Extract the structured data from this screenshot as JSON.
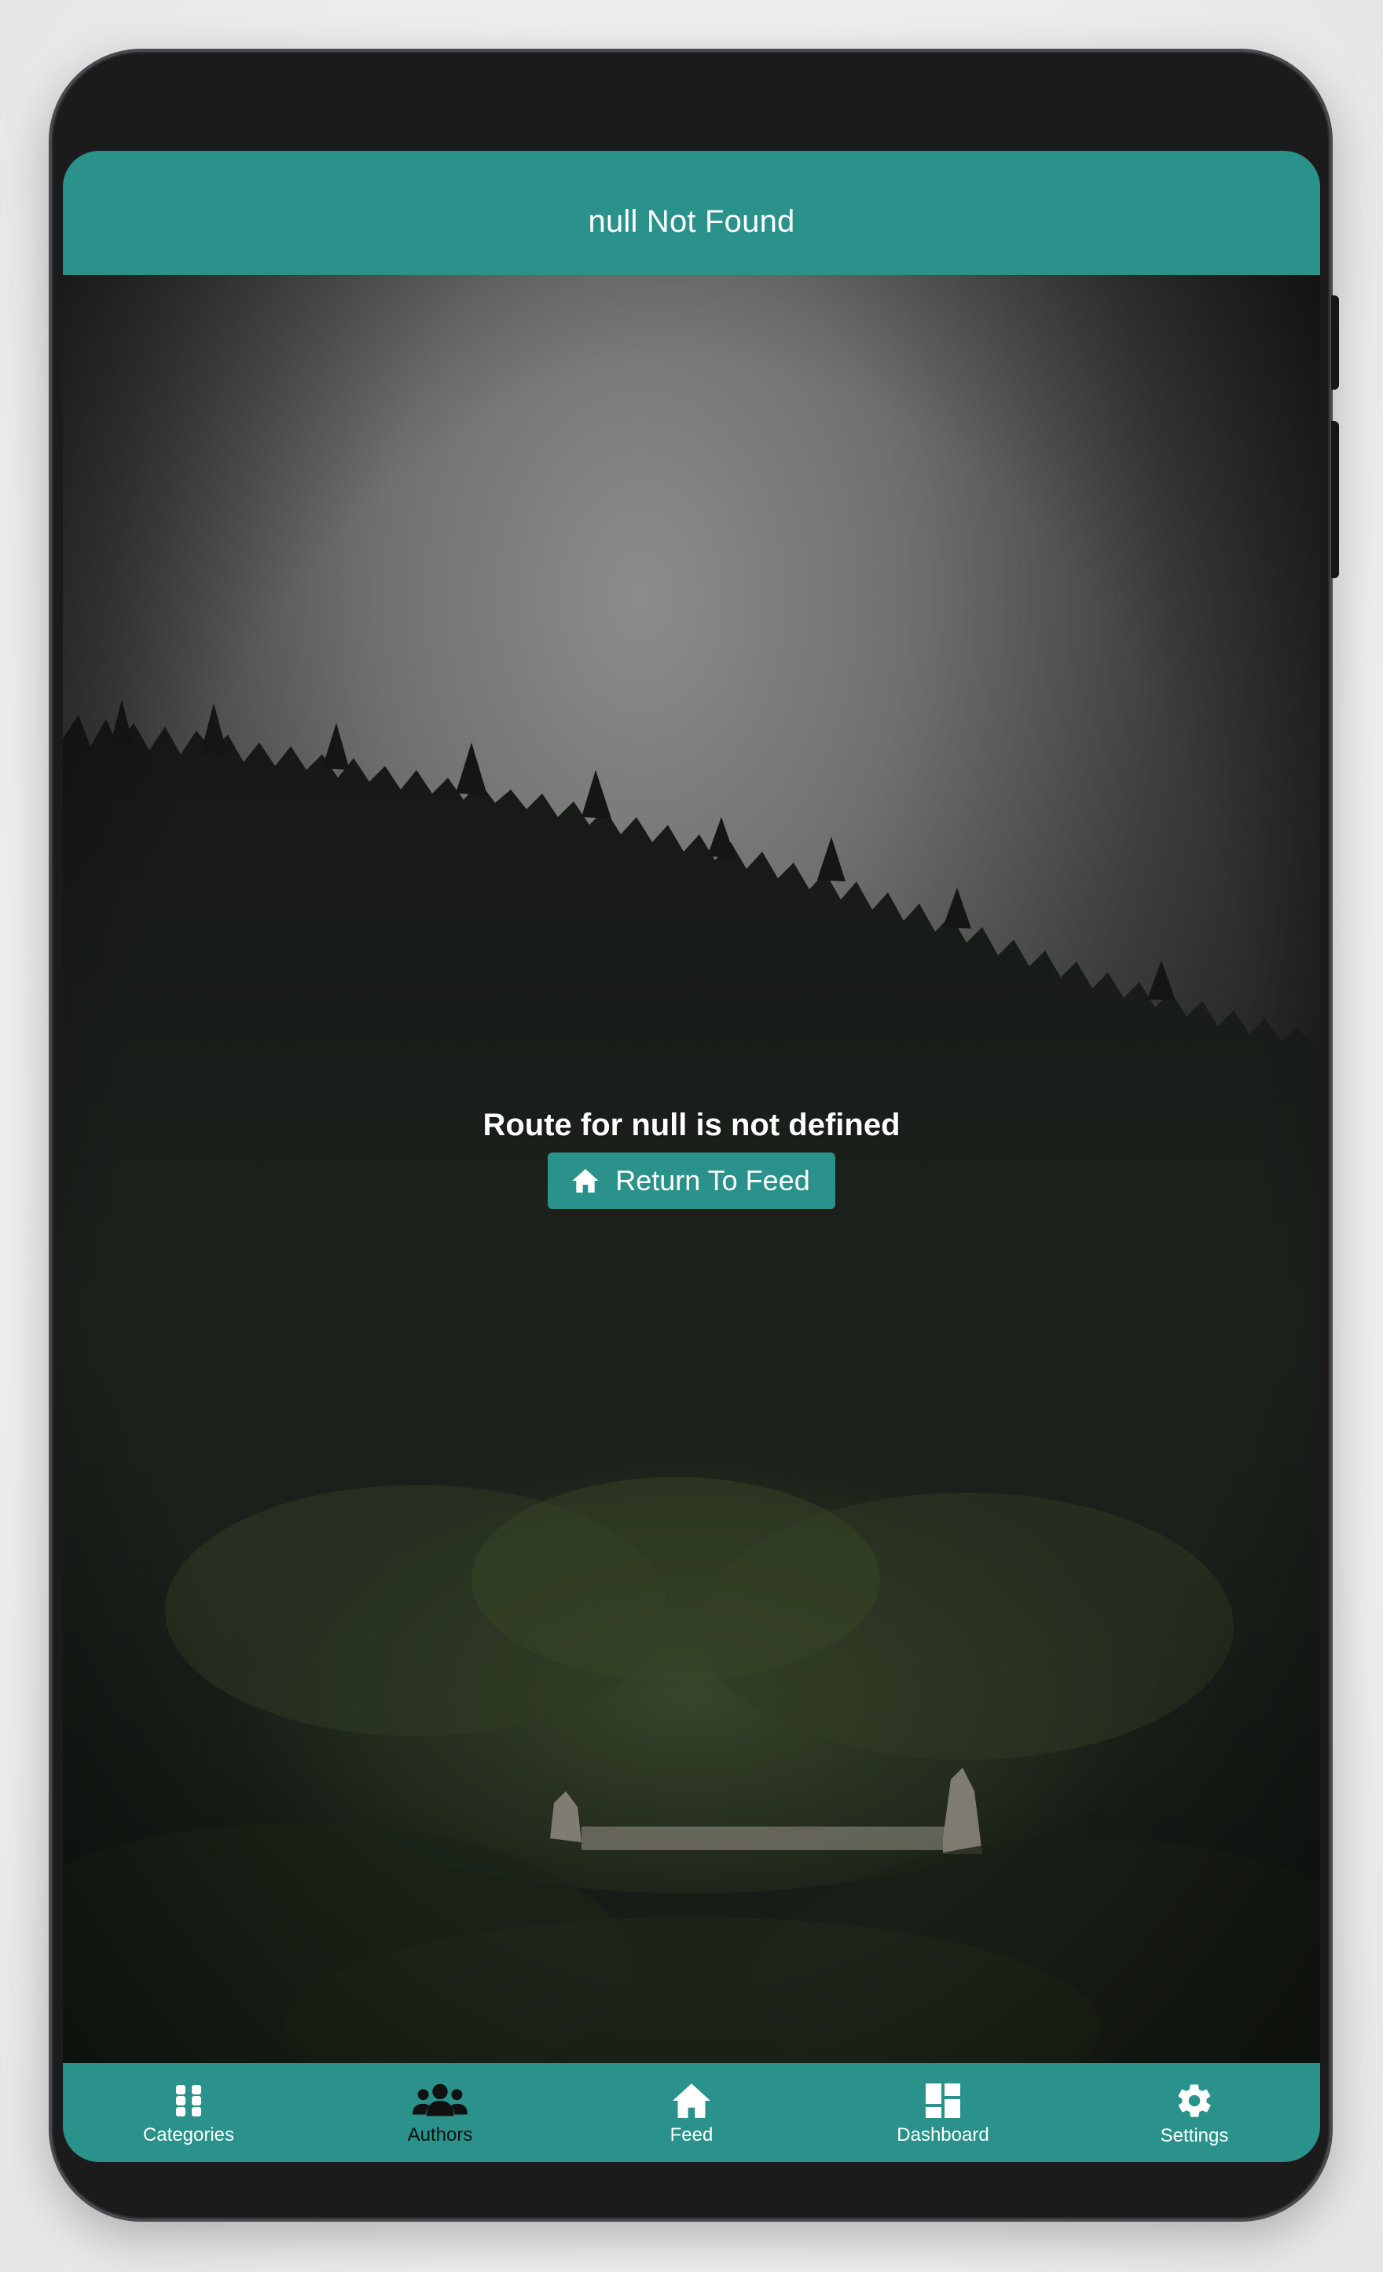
{
  "app_bar": {
    "title": "null Not Found"
  },
  "error": {
    "message": "Route for null is not defined",
    "button_label": "Return To Feed",
    "button_icon": "home-icon"
  },
  "bottom_nav": {
    "items": [
      {
        "label": "Categories",
        "icon": "grid-icon",
        "active": false
      },
      {
        "label": "Authors",
        "icon": "users-icon",
        "active": true
      },
      {
        "label": "Feed",
        "icon": "home-icon",
        "active": false
      },
      {
        "label": "Dashboard",
        "icon": "dashboard-icon",
        "active": false
      },
      {
        "label": "Settings",
        "icon": "gear-icon",
        "active": false
      }
    ]
  },
  "colors": {
    "accent": "#2a918b",
    "frame": "#1b1b1c",
    "text_on_accent": "#ffffff",
    "active_nav_label": "#111111"
  }
}
